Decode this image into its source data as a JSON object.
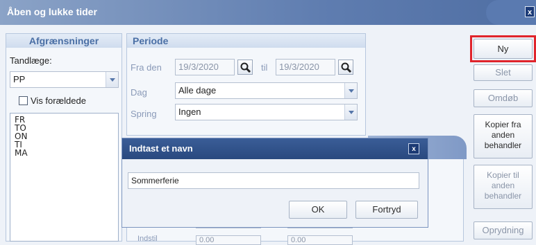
{
  "window": {
    "title": "Åben og lukke tider",
    "close_label": "x"
  },
  "afgraensninger": {
    "header": "Afgrænsninger",
    "tandlaege_label": "Tandlæge:",
    "tandlaege_value": "PP",
    "vis_foraeldede_label": "Vis forældede",
    "vis_foraeldede_checked": false,
    "list_items": [
      "FR",
      "TO",
      "ON",
      "TI",
      "MA"
    ]
  },
  "periode": {
    "header": "Periode",
    "fra_den_label": "Fra den",
    "fra_den_value": "19/3/2020",
    "til_label": "til",
    "til_value": "19/3/2020",
    "dag_label": "Dag",
    "dag_value": "Alle dage",
    "spring_label": "Spring",
    "spring_value": "Ingen"
  },
  "buttons": {
    "ny": "Ny",
    "slet": "Slet",
    "omdob": "Omdøb",
    "kopier_fra": "Kopier fra anden behandler",
    "kopier_til": "Kopier til anden behandler",
    "oprydning": "Oprydning"
  },
  "dialog": {
    "title": "Indtast et navn",
    "close_label": "x",
    "input_value": "Sommerferie",
    "ok": "OK",
    "fortryd": "Fortryd"
  },
  "background_fields": {
    "value_a": "0.00",
    "value_b": "0.00"
  },
  "colors": {
    "highlight": "#e0242b",
    "title_bar": "#5f7db0",
    "dialog_title": "#2f5089"
  },
  "icons": [
    "close-icon",
    "magnifier-icon",
    "chevron-down-icon"
  ]
}
